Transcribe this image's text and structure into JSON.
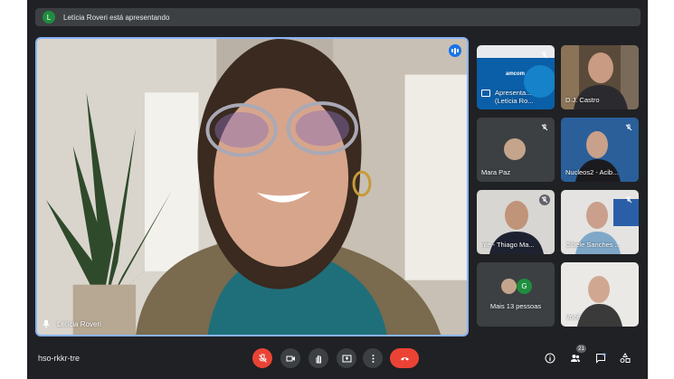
{
  "banner": {
    "avatar_letter": "L",
    "text": "Letícia Roveri está apresentando"
  },
  "main": {
    "name": "Letícia Roveri"
  },
  "tiles": [
    {
      "name": "Apresenta... (Letícia Ro...",
      "logo": "amcom"
    },
    {
      "name": "D.J. Castro"
    },
    {
      "name": "Mara Paz"
    },
    {
      "name": "Nucleos2 - Acib..."
    },
    {
      "name": "nte - Thiago Ma..."
    },
    {
      "name": "Cibele Sanches ..."
    },
    {
      "name": "Mais 13 pessoas",
      "avatar_letter": "G"
    },
    {
      "name": "Você"
    }
  ],
  "bottom": {
    "meeting_code": "hso-rkkr-tre",
    "participants_count": "21"
  },
  "colors": {
    "accent_blue": "#1a73e8",
    "active_border": "#8ab4f8",
    "red": "#ea4335",
    "bg": "#202124",
    "tile": "#3c4043",
    "avatar_green": "#1e8e3e"
  },
  "icons": [
    "microphone-off-icon",
    "camera-icon",
    "raise-hand-icon",
    "present-icon",
    "more-icon",
    "end-call-icon",
    "info-icon",
    "people-icon",
    "chat-icon",
    "activities-icon",
    "pin-icon",
    "speaking-icon"
  ]
}
